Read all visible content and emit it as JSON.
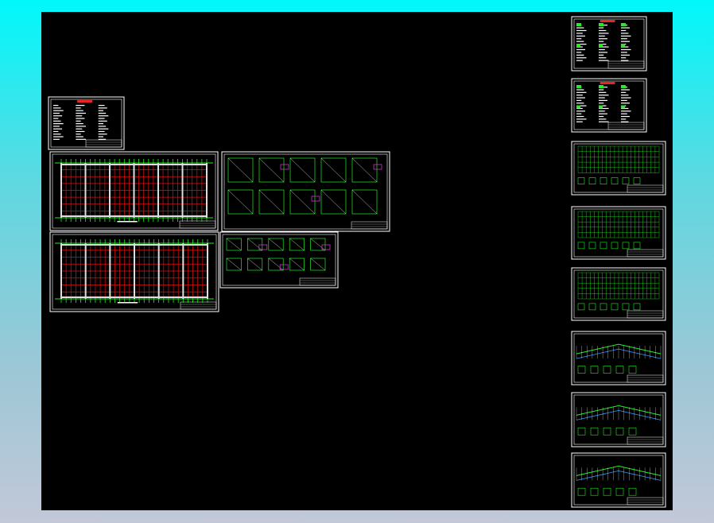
{
  "colors": {
    "background_top": "#00f8fb",
    "canvas": "#000000",
    "frame": "#ffffff",
    "grid_green": "#22ee22",
    "grid_red": "#dd1111",
    "highlight_magenta": "#cc33cc"
  },
  "sheets": [
    {
      "kind": "notes"
    },
    {
      "kind": "plan"
    },
    {
      "kind": "detail"
    },
    {
      "kind": "plan"
    },
    {
      "kind": "detail"
    },
    {
      "kind": "notes"
    },
    {
      "kind": "notes"
    },
    {
      "kind": "greenplan"
    },
    {
      "kind": "greenplan"
    },
    {
      "kind": "greenplan"
    },
    {
      "kind": "elevation"
    },
    {
      "kind": "elevation"
    },
    {
      "kind": "elevation"
    }
  ]
}
